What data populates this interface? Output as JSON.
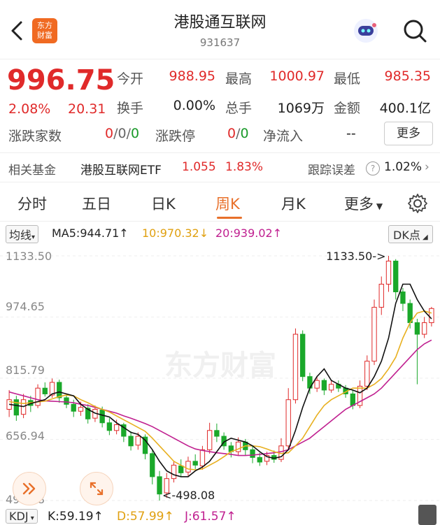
{
  "header": {
    "title": "港股通互联网",
    "code": "931637",
    "logo_line1": "东方",
    "logo_line2": "财富"
  },
  "quote": {
    "price": "996.75",
    "change_pct": "2.08%",
    "change_amt": "20.31",
    "open_label": "今开",
    "open": "988.95",
    "high_label": "最高",
    "high": "1000.97",
    "low_label": "最低",
    "low": "985.35",
    "turnover_label": "换手",
    "turnover": "0.00%",
    "volume_label": "总手",
    "volume": "1069万",
    "amount_label": "金额",
    "amount": "400.1亿",
    "updown_label": "涨跌家数",
    "up": "0",
    "flat": "0",
    "down": "0",
    "limit_label": "涨跌停",
    "limit_up": "0",
    "limit_down": "0",
    "inflow_label": "净流入",
    "inflow": "--",
    "more_label": "更多",
    "slash": "/"
  },
  "fund": {
    "label": "相关基金",
    "name": "港股互联网ETF",
    "price": "1.055",
    "change": "1.83%",
    "tracking_label": "跟踪误差",
    "tracking": "1.02%"
  },
  "tabs": [
    "分时",
    "五日",
    "日K",
    "周K",
    "月K",
    "更多"
  ],
  "active_tab": 3,
  "indicator": {
    "type": "均线",
    "ma5": "MA5:944.71↑",
    "ma10": "10:970.32↓",
    "ma20": "20:939.02↑",
    "dk": "DK点",
    "kdj": "KDJ",
    "k": "K:59.19↑",
    "d": "D:57.99↑",
    "j": "J:61.57↑"
  },
  "chart_data": {
    "type": "candlestick",
    "y_ticks": [
      "1133.50",
      "974.65",
      "815.79",
      "656.94",
      "498.08"
    ],
    "ylim": [
      498.08,
      1133.5
    ],
    "high_annotation": "1133.50->",
    "low_annotation": "<-498.08",
    "watermark": "东方财富",
    "candles": [
      {
        "o": 735,
        "c": 760,
        "h": 785,
        "l": 715
      },
      {
        "o": 760,
        "c": 720,
        "h": 770,
        "l": 705
      },
      {
        "o": 722,
        "c": 760,
        "h": 775,
        "l": 712
      },
      {
        "o": 758,
        "c": 745,
        "h": 770,
        "l": 728
      },
      {
        "o": 745,
        "c": 790,
        "h": 800,
        "l": 738
      },
      {
        "o": 790,
        "c": 775,
        "h": 805,
        "l": 768
      },
      {
        "o": 772,
        "c": 805,
        "h": 815,
        "l": 765
      },
      {
        "o": 805,
        "c": 765,
        "h": 812,
        "l": 752
      },
      {
        "o": 765,
        "c": 748,
        "h": 775,
        "l": 738
      },
      {
        "o": 748,
        "c": 730,
        "h": 760,
        "l": 715
      },
      {
        "o": 730,
        "c": 740,
        "h": 755,
        "l": 718
      },
      {
        "o": 738,
        "c": 710,
        "h": 748,
        "l": 698
      },
      {
        "o": 712,
        "c": 735,
        "h": 745,
        "l": 702
      },
      {
        "o": 733,
        "c": 700,
        "h": 742,
        "l": 688
      },
      {
        "o": 700,
        "c": 680,
        "h": 712,
        "l": 668
      },
      {
        "o": 680,
        "c": 695,
        "h": 708,
        "l": 670
      },
      {
        "o": 695,
        "c": 665,
        "h": 700,
        "l": 650
      },
      {
        "o": 665,
        "c": 640,
        "h": 678,
        "l": 628
      },
      {
        "o": 642,
        "c": 665,
        "h": 675,
        "l": 630
      },
      {
        "o": 663,
        "c": 620,
        "h": 670,
        "l": 605
      },
      {
        "o": 620,
        "c": 560,
        "h": 630,
        "l": 540
      },
      {
        "o": 560,
        "c": 515,
        "h": 575,
        "l": 498
      },
      {
        "o": 518,
        "c": 555,
        "h": 570,
        "l": 505
      },
      {
        "o": 555,
        "c": 590,
        "h": 600,
        "l": 545
      },
      {
        "o": 588,
        "c": 570,
        "h": 605,
        "l": 560
      },
      {
        "o": 572,
        "c": 600,
        "h": 612,
        "l": 562
      },
      {
        "o": 600,
        "c": 590,
        "h": 618,
        "l": 580
      },
      {
        "o": 588,
        "c": 630,
        "h": 640,
        "l": 578
      },
      {
        "o": 630,
        "c": 680,
        "h": 700,
        "l": 620
      },
      {
        "o": 680,
        "c": 665,
        "h": 698,
        "l": 650
      },
      {
        "o": 665,
        "c": 640,
        "h": 675,
        "l": 630
      },
      {
        "o": 640,
        "c": 625,
        "h": 650,
        "l": 610
      },
      {
        "o": 625,
        "c": 650,
        "h": 662,
        "l": 615
      },
      {
        "o": 650,
        "c": 630,
        "h": 658,
        "l": 616
      },
      {
        "o": 630,
        "c": 610,
        "h": 640,
        "l": 595
      },
      {
        "o": 610,
        "c": 598,
        "h": 622,
        "l": 588
      },
      {
        "o": 600,
        "c": 615,
        "h": 625,
        "l": 590
      },
      {
        "o": 615,
        "c": 605,
        "h": 628,
        "l": 596
      },
      {
        "o": 605,
        "c": 640,
        "h": 660,
        "l": 598
      },
      {
        "o": 640,
        "c": 760,
        "h": 790,
        "l": 632
      },
      {
        "o": 760,
        "c": 930,
        "h": 945,
        "l": 750
      },
      {
        "o": 930,
        "c": 820,
        "h": 940,
        "l": 808
      },
      {
        "o": 820,
        "c": 790,
        "h": 830,
        "l": 775
      },
      {
        "o": 790,
        "c": 810,
        "h": 822,
        "l": 780
      },
      {
        "o": 810,
        "c": 785,
        "h": 815,
        "l": 772
      },
      {
        "o": 785,
        "c": 800,
        "h": 812,
        "l": 778
      },
      {
        "o": 800,
        "c": 790,
        "h": 810,
        "l": 780
      },
      {
        "o": 790,
        "c": 775,
        "h": 798,
        "l": 765
      },
      {
        "o": 775,
        "c": 745,
        "h": 785,
        "l": 735
      },
      {
        "o": 745,
        "c": 795,
        "h": 810,
        "l": 738
      },
      {
        "o": 795,
        "c": 860,
        "h": 875,
        "l": 785
      },
      {
        "o": 860,
        "c": 1000,
        "h": 1020,
        "l": 850
      },
      {
        "o": 1000,
        "c": 1060,
        "h": 1080,
        "l": 980
      },
      {
        "o": 1060,
        "c": 1120,
        "h": 1133.5,
        "l": 1040
      },
      {
        "o": 1120,
        "c": 1040,
        "h": 1125,
        "l": 1020
      },
      {
        "o": 1040,
        "c": 1010,
        "h": 1050,
        "l": 990
      },
      {
        "o": 1010,
        "c": 960,
        "h": 1020,
        "l": 945
      },
      {
        "o": 960,
        "c": 930,
        "h": 970,
        "l": 800
      },
      {
        "o": 930,
        "c": 960,
        "h": 975,
        "l": 920
      },
      {
        "o": 960,
        "c": 996.75,
        "h": 1000.97,
        "l": 950
      }
    ],
    "ma5": [
      748,
      745,
      742,
      750,
      755,
      760,
      775,
      780,
      775,
      770,
      748,
      735,
      725,
      720,
      715,
      700,
      688,
      675,
      670,
      655,
      630,
      600,
      575,
      565,
      560,
      560,
      575,
      585,
      600,
      625,
      650,
      660,
      655,
      650,
      640,
      625,
      612,
      608,
      612,
      630,
      680,
      740,
      790,
      820,
      840,
      810,
      800,
      790,
      785,
      778,
      790,
      820,
      860,
      920,
      1010,
      1060,
      1060,
      1020,
      990,
      970
    ],
    "ma10": [
      755,
      752,
      750,
      752,
      754,
      756,
      762,
      768,
      772,
      770,
      760,
      752,
      742,
      735,
      728,
      718,
      708,
      698,
      688,
      678,
      660,
      640,
      620,
      600,
      590,
      580,
      578,
      580,
      590,
      600,
      612,
      625,
      632,
      640,
      640,
      638,
      632,
      625,
      620,
      622,
      640,
      660,
      690,
      720,
      745,
      760,
      770,
      780,
      790,
      790,
      790,
      800,
      815,
      840,
      870,
      920,
      960,
      985,
      990,
      985
    ],
    "ma20": [
      780,
      775,
      770,
      765,
      760,
      757,
      756,
      755,
      754,
      752,
      748,
      745,
      740,
      735,
      730,
      725,
      718,
      712,
      705,
      698,
      690,
      680,
      670,
      660,
      650,
      640,
      632,
      628,
      625,
      622,
      620,
      618,
      615,
      615,
      616,
      618,
      620,
      622,
      625,
      630,
      640,
      650,
      660,
      675,
      690,
      705,
      720,
      735,
      745,
      755,
      765,
      775,
      790,
      810,
      830,
      850,
      870,
      890,
      905,
      915
    ]
  }
}
